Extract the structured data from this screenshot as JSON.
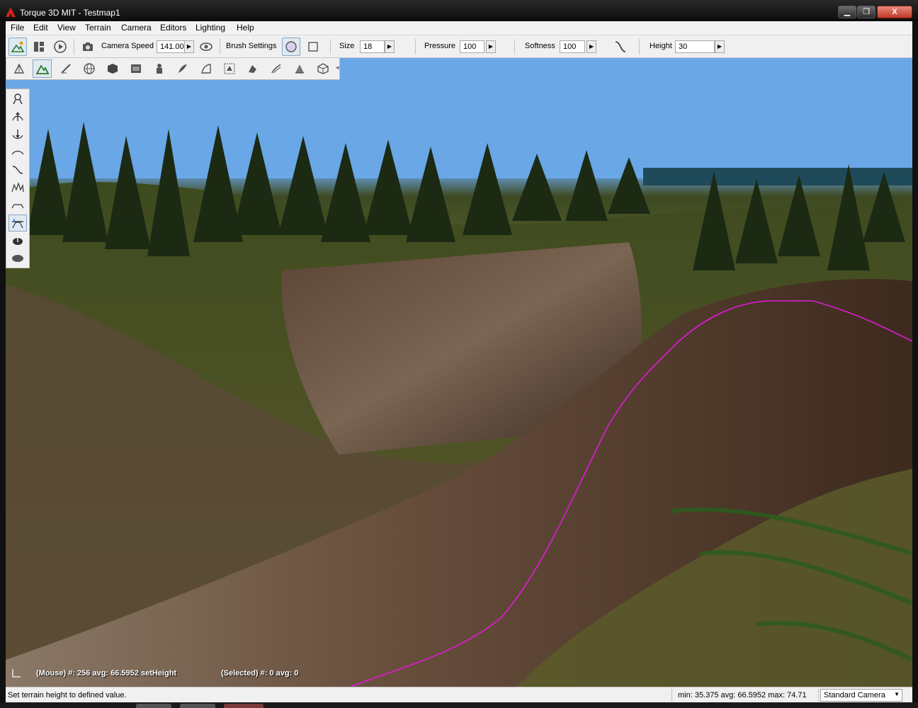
{
  "window": {
    "title": "Torque 3D MIT - Testmap1",
    "controls": {
      "minimize": "▁",
      "maximize": "❐",
      "close": "X"
    }
  },
  "menubar": {
    "items": [
      "File",
      "Edit",
      "View",
      "Terrain",
      "Camera",
      "Editors",
      "Lighting",
      "Help"
    ]
  },
  "toolbar": {
    "camera_speed_label": "Camera Speed",
    "camera_speed_value": "141.00",
    "brush_settings_label": "Brush Settings",
    "size_label": "Size",
    "size_value": "18",
    "pressure_label": "Pressure",
    "pressure_value": "100",
    "softness_label": "Softness",
    "softness_value": "100",
    "height_label": "Height",
    "height_value": "30"
  },
  "editor_palette": {
    "tools": [
      "object-editor-icon",
      "terrain-editor-icon",
      "terrain-painter-icon",
      "world-icon",
      "shape-icon",
      "datablock-icon",
      "particle-icon",
      "decal-icon",
      "road-icon",
      "forest-icon",
      "mesh-road-icon",
      "river-icon",
      "navmesh-icon",
      "convex-icon"
    ],
    "active_index": 1
  },
  "action_palette": {
    "tools": [
      "grab-terrain-icon",
      "raise-height-icon",
      "lower-height-icon",
      "smooth-icon",
      "smooth-slope-icon",
      "paint-noise-icon",
      "flatten-icon",
      "set-height-icon",
      "clear-terrain-icon",
      "restore-terrain-icon"
    ],
    "active_index": 7
  },
  "viewport": {
    "mouse_info": "(Mouse) #: 256  avg: 66.5952 setHeight",
    "selected_info": "(Selected) #: 0  avg: 0",
    "colors": {
      "sky": "#6aa7e7",
      "selection_outline": "#e11ad8"
    }
  },
  "statusbar": {
    "message": "Set terrain height to defined value.",
    "stats": "min: 35.375  avg: 66.5952  max: 74.71",
    "camera_mode": "Standard Camera"
  }
}
